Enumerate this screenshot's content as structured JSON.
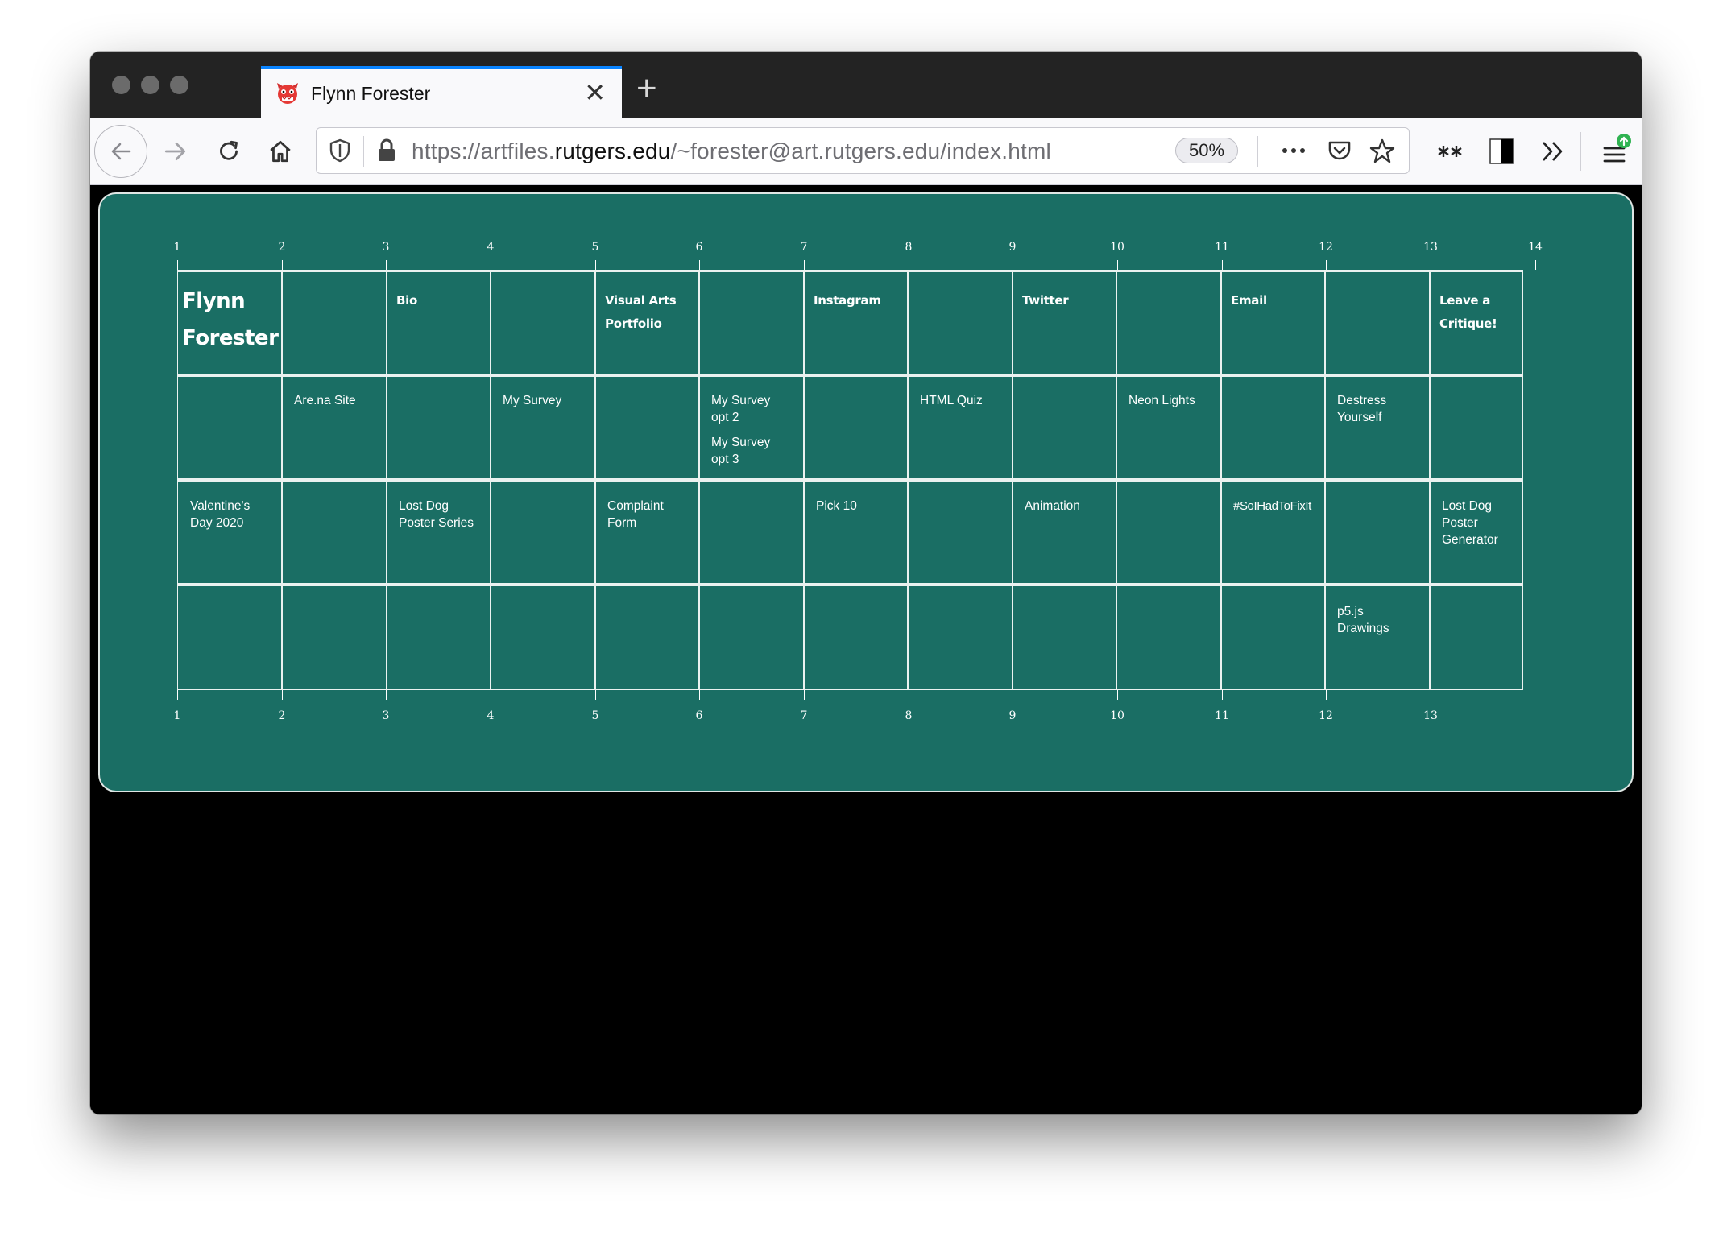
{
  "browser": {
    "tab_title": "Flynn Forester",
    "url_prefix": "https://artfiles.",
    "url_domain": "rutgers.edu",
    "url_path": "/~forester@art.rutgers.edu/index.html",
    "zoom": "50%",
    "colors": {
      "chrome": "#232323",
      "toolbar": "#f9f9fb",
      "tab_accent": "#0a84ff"
    }
  },
  "page": {
    "background": "#1a6e64",
    "ruler_top": [
      "1",
      "2",
      "3",
      "4",
      "5",
      "6",
      "7",
      "8",
      "9",
      "10",
      "11",
      "12",
      "13",
      "14"
    ],
    "ruler_bottom": [
      "1",
      "2",
      "3",
      "4",
      "5",
      "6",
      "7",
      "8",
      "9",
      "10",
      "11",
      "12",
      "13"
    ],
    "name": [
      "Flynn",
      "Forester"
    ],
    "nav": {
      "bio": "Bio",
      "visual_arts": [
        "Visual Arts",
        "Portfolio"
      ],
      "instagram": "Instagram",
      "twitter": "Twitter",
      "email": "Email",
      "critique": [
        "Leave a",
        "Critique!"
      ]
    },
    "projects": {
      "arena": "Are.na Site",
      "survey": "My Survey",
      "survey2": [
        "My Survey",
        "opt 2"
      ],
      "survey3": [
        "My Survey",
        "opt 3"
      ],
      "html_quiz": "HTML Quiz",
      "neon": "Neon Lights",
      "destress": [
        "Destress",
        "Yourself"
      ],
      "valentines": [
        "Valentine's",
        "Day 2020"
      ],
      "lost_dog": [
        "Lost Dog",
        "Poster Series"
      ],
      "complaint": [
        "Complaint",
        "Form"
      ],
      "pick10": "Pick 10",
      "animation": "Animation",
      "hashtag": "#SoIHadToFixIt",
      "lost_dog_gen": [
        "Lost Dog",
        "Poster",
        "Generator"
      ],
      "p5js": [
        "p5.js",
        "Drawings"
      ]
    }
  }
}
